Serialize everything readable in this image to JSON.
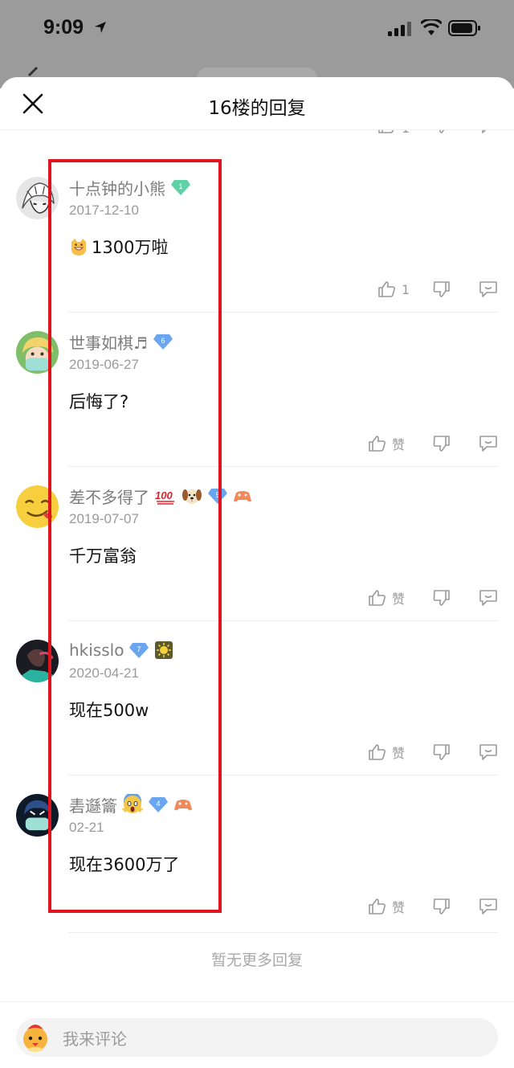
{
  "status_bar": {
    "time": "9:09"
  },
  "sheet": {
    "title": "16楼的回复"
  },
  "prev_item": {
    "like_count": "1"
  },
  "replies": [
    {
      "username": "十点钟的小熊",
      "level": "1",
      "date": "2017-12-10",
      "content": "1300万啦",
      "like_label": "1"
    },
    {
      "username": "世事如棋♬",
      "level": "6",
      "date": "2019-06-27",
      "content": "后悔了?",
      "like_label": "赞"
    },
    {
      "username": "差不多得了",
      "level": "5",
      "date": "2019-07-07",
      "content": "千万富翁",
      "like_label": "赞"
    },
    {
      "username": "hkisslo",
      "level": "7",
      "date": "2020-04-21",
      "content": "现在500w",
      "like_label": "赞"
    },
    {
      "username": "砉邎籥",
      "level": "4",
      "date": "02-21",
      "content": "现在3600万了",
      "like_label": "赞"
    }
  ],
  "footer": {
    "no_more": "暂无更多回复"
  },
  "composer": {
    "placeholder": "我来评论"
  },
  "colors": {
    "highlight": "#e0141e",
    "diamond_green": "#5fd0a8",
    "diamond_blue": "#6aa6f0"
  },
  "icons": [
    "close-icon",
    "thumbs-up-icon",
    "thumbs-down-icon",
    "comment-icon",
    "diamond-badge-icon"
  ]
}
